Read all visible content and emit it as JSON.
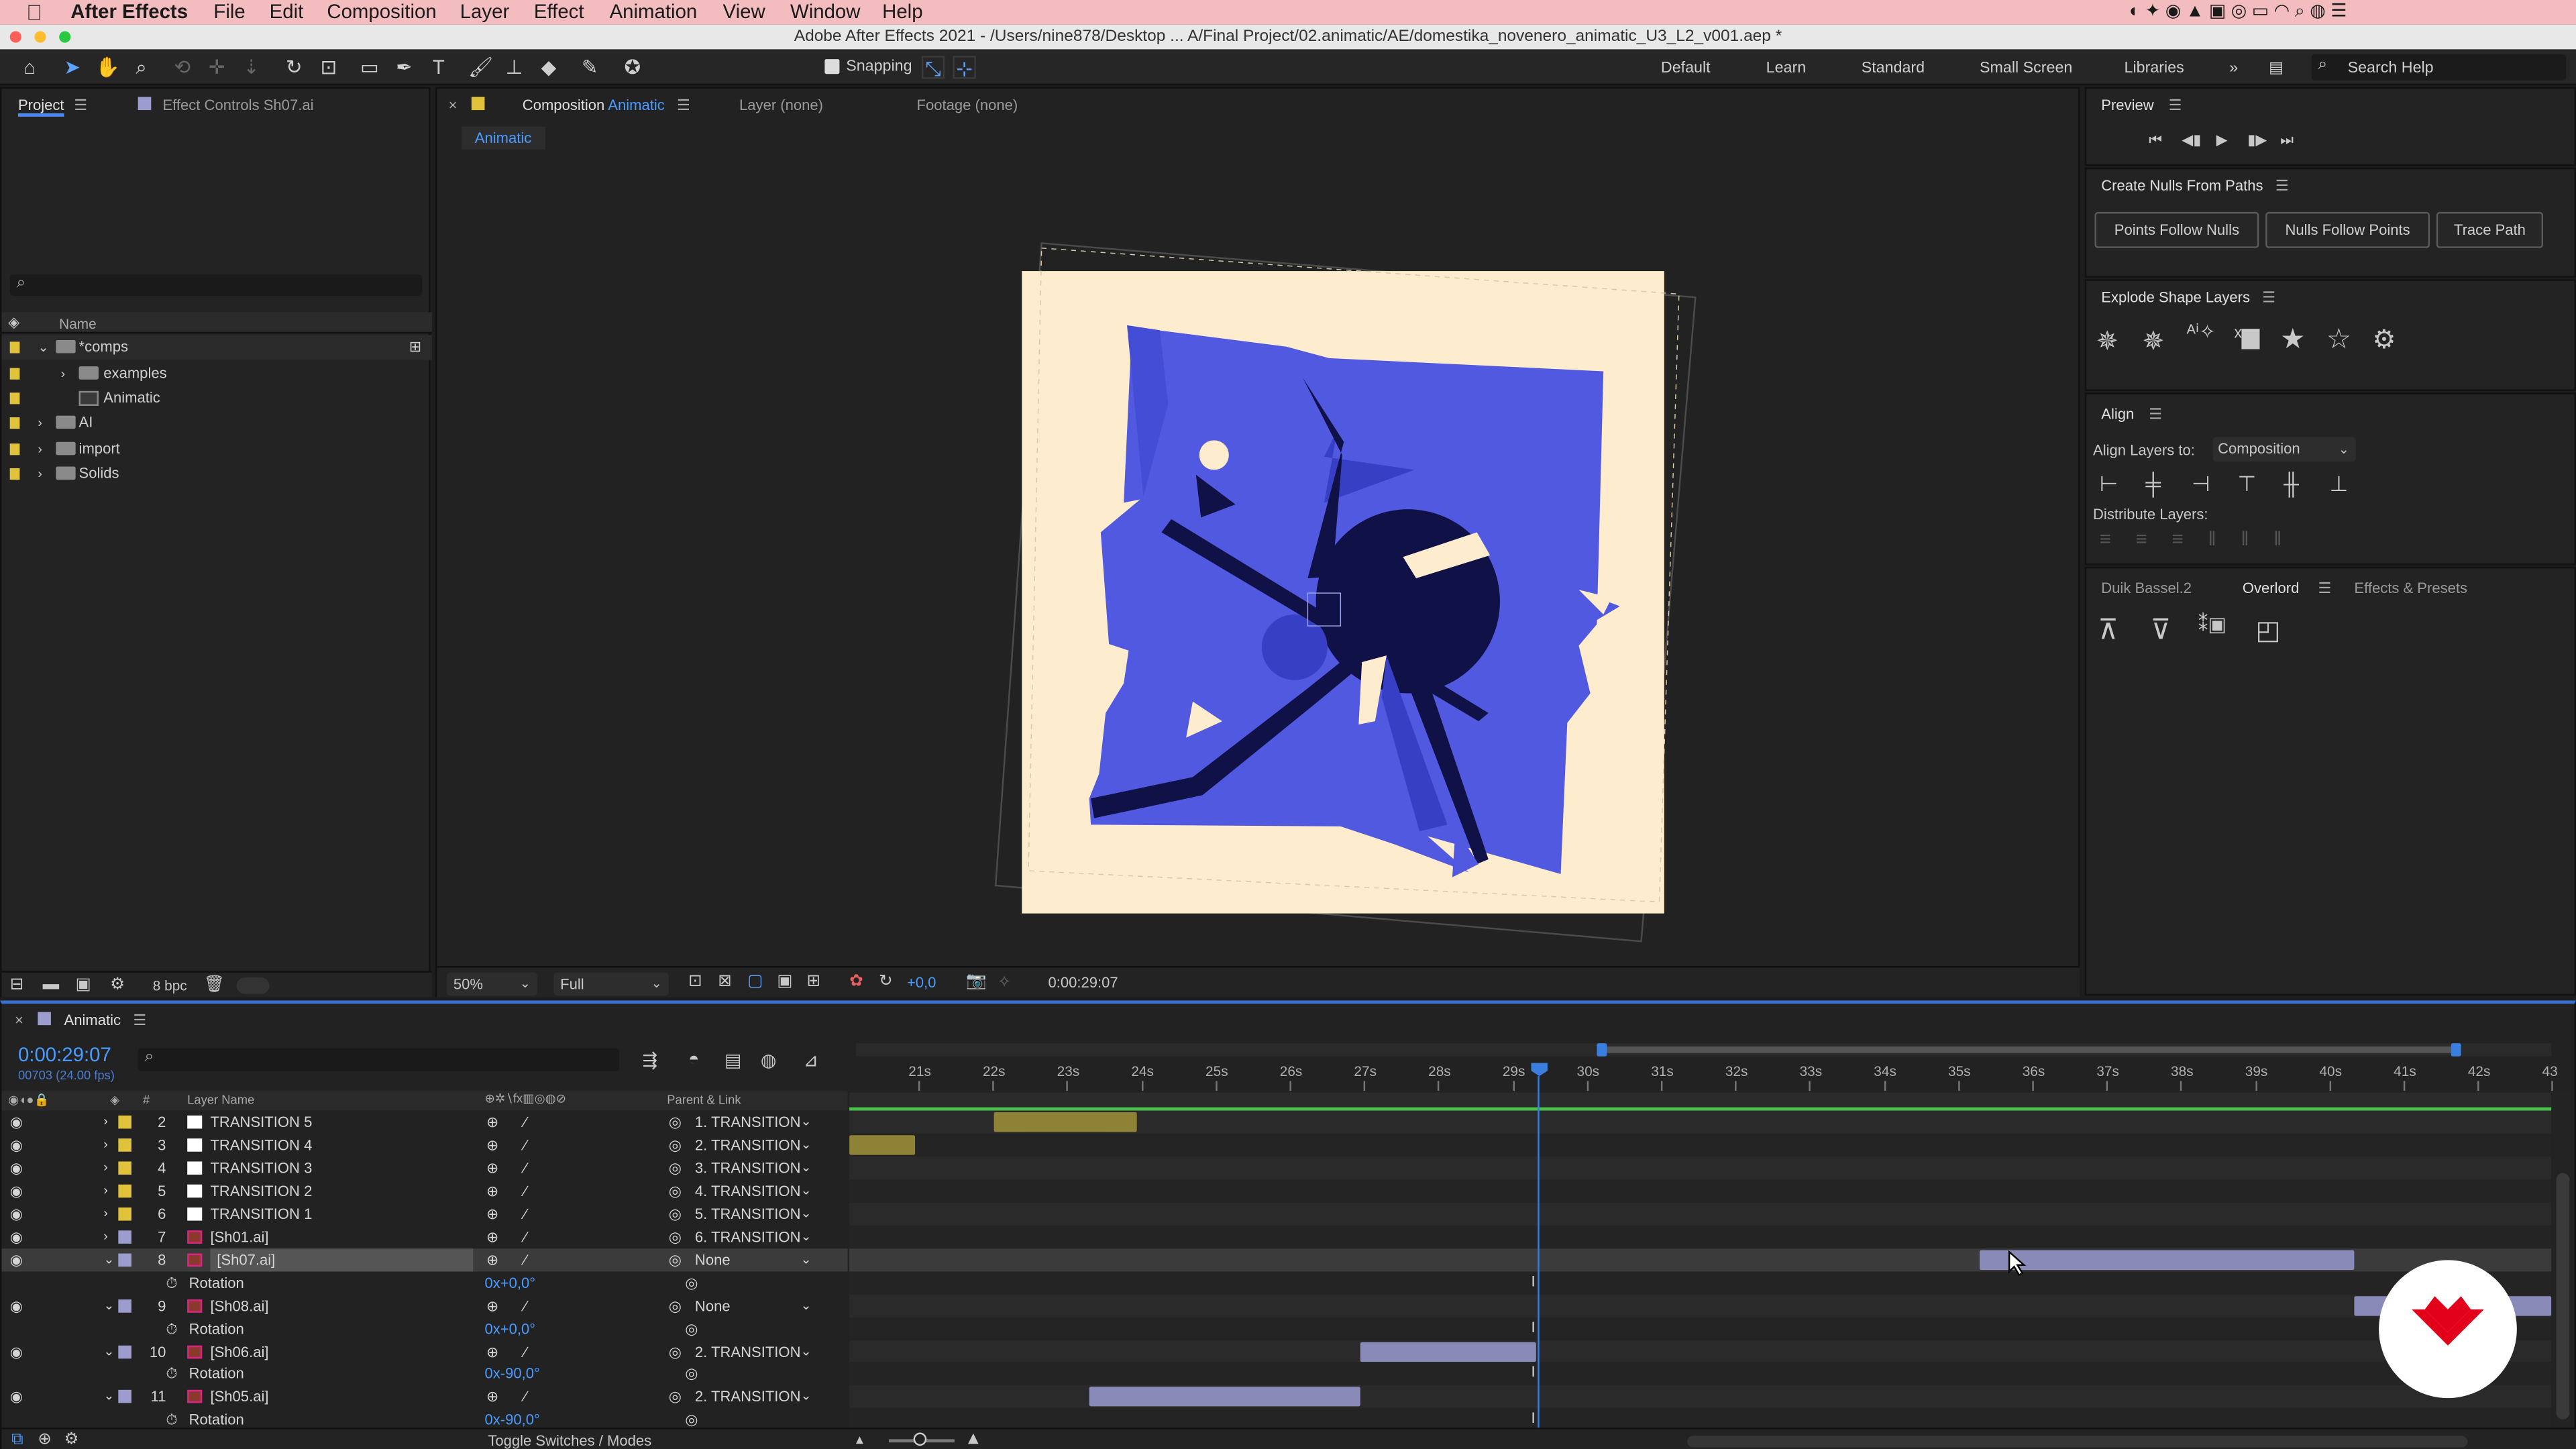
{
  "menubar": {
    "app": "After Effects",
    "items": [
      "File",
      "Edit",
      "Composition",
      "Layer",
      "Effect",
      "Animation",
      "View",
      "Window",
      "Help"
    ]
  },
  "titlebar": {
    "title": "Adobe After Effects 2021 - /Users/nine878/Desktop ... A/Final Project/02.animatic/AE/domestika_novenero_animatic_U3_L2_v001.aep *"
  },
  "toolbar": {
    "snapping": "Snapping",
    "workspaces": [
      "Default",
      "Learn",
      "Standard",
      "Small Screen",
      "Libraries"
    ],
    "search": "Search Help"
  },
  "project": {
    "tab": "Project",
    "tab2": "Effect Controls Sh07.ai",
    "col_name": "Name",
    "bpc": "8 bpc",
    "items": [
      {
        "label": "*comps",
        "color": "#e0c23b"
      },
      {
        "label": "examples",
        "color": "#e0c23b"
      },
      {
        "label": "Animatic",
        "color": "#e0c23b"
      },
      {
        "label": "AI",
        "color": "#e0c23b"
      },
      {
        "label": "import",
        "color": "#e0c23b"
      },
      {
        "label": "Solids",
        "color": "#e0c23b"
      }
    ]
  },
  "comp": {
    "tab_prefix": "Composition",
    "tab_name": "Animatic",
    "layer_tab": "Layer (none)",
    "footage_tab": "Footage (none)",
    "breadcrumb": "Animatic",
    "zoom": "50%",
    "resolution": "Full",
    "exposure": "+0,0",
    "timecode": "0:00:29:07"
  },
  "preview": {
    "title": "Preview"
  },
  "nulls": {
    "title": "Create Nulls From Paths",
    "buttons": [
      "Points Follow Nulls",
      "Nulls Follow Points",
      "Trace Path"
    ]
  },
  "explode": {
    "title": "Explode Shape Layers"
  },
  "align": {
    "title": "Align",
    "align_to_label": "Align Layers to:",
    "align_to_value": "Composition",
    "distribute": "Distribute Layers:"
  },
  "bottom_tabs": {
    "duik": "Duik Bassel.2",
    "overlord": "Overlord",
    "effects": "Effects & Presets"
  },
  "timeline": {
    "tab": "Animatic",
    "timecode": "0:00:29:07",
    "frames": "00703 (24.00 fps)",
    "col_layer": "Layer Name",
    "col_parent": "Parent & Link",
    "toggle": "Toggle Switches / Modes",
    "ticks": [
      "21s",
      "22s",
      "23s",
      "24s",
      "25s",
      "26s",
      "27s",
      "28s",
      "29s",
      "30s",
      "31s",
      "32s",
      "33s",
      "34s",
      "35s",
      "36s",
      "37s",
      "38s",
      "39s",
      "40s",
      "41s",
      "42s",
      "43"
    ],
    "layers": [
      {
        "num": "2",
        "name": "TRANSITION 5",
        "parent": "1. TRANSITION",
        "label": "#e0c23b",
        "type": "solid"
      },
      {
        "num": "3",
        "name": "TRANSITION 4",
        "parent": "2. TRANSITION",
        "label": "#e0c23b",
        "type": "solid"
      },
      {
        "num": "4",
        "name": "TRANSITION 3",
        "parent": "3. TRANSITION",
        "label": "#e0c23b",
        "type": "solid"
      },
      {
        "num": "5",
        "name": "TRANSITION 2",
        "parent": "4. TRANSITION",
        "label": "#e0c23b",
        "type": "solid"
      },
      {
        "num": "6",
        "name": "TRANSITION 1",
        "parent": "5. TRANSITION",
        "label": "#e0c23b",
        "type": "solid"
      },
      {
        "num": "7",
        "name": "[Sh01.ai]",
        "parent": "6. TRANSITION",
        "label": "#9c9ccf",
        "type": "ai"
      },
      {
        "num": "8",
        "name": "[Sh07.ai]",
        "parent": "None",
        "label": "#9c9ccf",
        "type": "ai",
        "selected": true
      },
      {
        "prop": "Rotation",
        "value": "0x+0,0°"
      },
      {
        "num": "9",
        "name": "[Sh08.ai]",
        "parent": "None",
        "label": "#9c9ccf",
        "type": "ai"
      },
      {
        "prop": "Rotation",
        "value": "0x+0,0°"
      },
      {
        "num": "10",
        "name": "[Sh06.ai]",
        "parent": "2. TRANSITION",
        "label": "#9c9ccf",
        "type": "ai"
      },
      {
        "prop": "Rotation",
        "value": "0x-90,0°"
      },
      {
        "num": "11",
        "name": "[Sh05.ai]",
        "parent": "2. TRANSITION",
        "label": "#9c9ccf",
        "type": "ai"
      },
      {
        "prop": "Rotation",
        "value": "0x-90,0°"
      }
    ]
  }
}
